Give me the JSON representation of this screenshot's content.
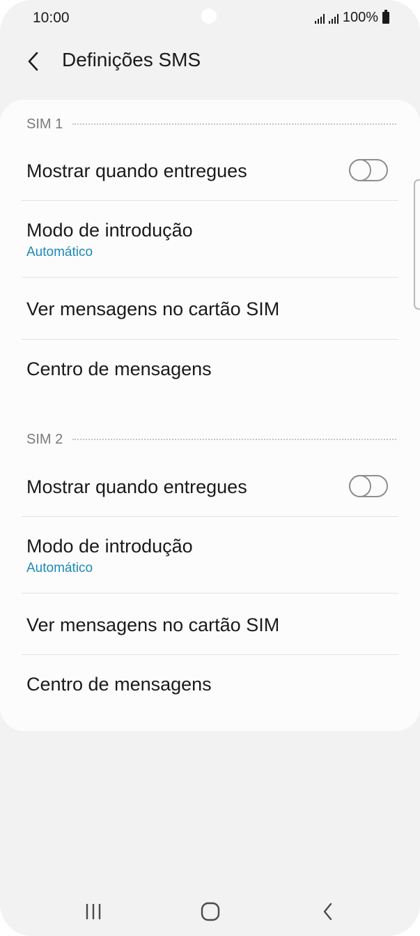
{
  "status_bar": {
    "time": "10:00",
    "battery": "100%"
  },
  "header": {
    "title": "Definições SMS"
  },
  "sections": [
    {
      "label": "SIM 1",
      "rows": [
        {
          "title": "Mostrar quando entregues",
          "toggle": false
        },
        {
          "title": "Modo de introdução",
          "subtitle": "Automático"
        },
        {
          "title": "Ver mensagens no cartão SIM"
        },
        {
          "title": "Centro de mensagens"
        }
      ]
    },
    {
      "label": "SIM 2",
      "rows": [
        {
          "title": "Mostrar quando entregues",
          "toggle": false
        },
        {
          "title": "Modo de introdução",
          "subtitle": "Automático"
        },
        {
          "title": "Ver mensagens no cartão SIM"
        },
        {
          "title": "Centro de mensagens"
        }
      ]
    }
  ],
  "colors": {
    "accent": "#1b8ab8",
    "background": "#f2f2f2",
    "card": "#fcfcfc"
  },
  "icons": {
    "back": "chevron-left-icon",
    "nav_recents": "recents-icon",
    "nav_home": "home-icon",
    "nav_back": "back-icon"
  }
}
